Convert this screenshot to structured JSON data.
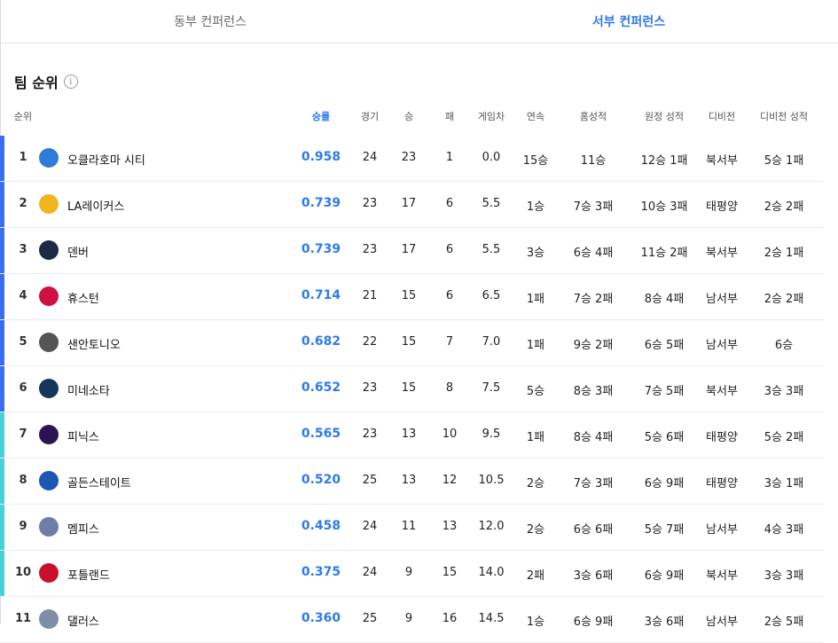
{
  "tabs": [
    {
      "label": "동부 컨퍼런스",
      "active": false
    },
    {
      "label": "서부 컨퍼런스",
      "active": true
    }
  ],
  "section": {
    "title": "팀 순위",
    "info_icon": "info-icon"
  },
  "columns": [
    "순위",
    "승률",
    "경기",
    "승",
    "패",
    "게임차",
    "연속",
    "홈성적",
    "원정 성적",
    "디비전",
    "디비전 성적"
  ],
  "colors": {
    "accent": "#2f7bea",
    "playoff_bar": "#3b6df0",
    "playin_bar": "#45d3d9"
  },
  "teams": [
    {
      "rank": "1",
      "name": "오클라호마 시티",
      "pct": "0.958",
      "gp": "24",
      "w": "23",
      "l": "1",
      "gb": "0.0",
      "streak": "15승",
      "home": "11승",
      "away": "12승 1패",
      "div": "북서부",
      "div_rec": "5승 1패",
      "zone": "playoff",
      "logo": "okc-thunder-logo",
      "logo_color": "#2f7bd9"
    },
    {
      "rank": "2",
      "name": "LA레이커스",
      "pct": "0.739",
      "gp": "23",
      "w": "17",
      "l": "6",
      "gb": "5.5",
      "streak": "1승",
      "home": "7승 3패",
      "away": "10승 3패",
      "div": "태평양",
      "div_rec": "2승 2패",
      "zone": "playoff",
      "logo": "lakers-logo",
      "logo_color": "#f2b51f"
    },
    {
      "rank": "3",
      "name": "덴버",
      "pct": "0.739",
      "gp": "23",
      "w": "17",
      "l": "6",
      "gb": "5.5",
      "streak": "3승",
      "home": "6승 4패",
      "away": "11승 2패",
      "div": "북서부",
      "div_rec": "2승 1패",
      "zone": "playoff",
      "logo": "nuggets-logo",
      "logo_color": "#1d2a44"
    },
    {
      "rank": "4",
      "name": "휴스턴",
      "pct": "0.714",
      "gp": "21",
      "w": "15",
      "l": "6",
      "gb": "6.5",
      "streak": "1패",
      "home": "7승 2패",
      "away": "8승 4패",
      "div": "남서부",
      "div_rec": "2승 2패",
      "zone": "playoff",
      "logo": "rockets-logo",
      "logo_color": "#ce1141"
    },
    {
      "rank": "5",
      "name": "샌안토니오",
      "pct": "0.682",
      "gp": "22",
      "w": "15",
      "l": "7",
      "gb": "7.0",
      "streak": "1패",
      "home": "9승 2패",
      "away": "6승 5패",
      "div": "남서부",
      "div_rec": "6승",
      "zone": "playoff",
      "logo": "spurs-logo",
      "logo_color": "#555555"
    },
    {
      "rank": "6",
      "name": "미네소타",
      "pct": "0.652",
      "gp": "23",
      "w": "15",
      "l": "8",
      "gb": "7.5",
      "streak": "5승",
      "home": "8승 3패",
      "away": "7승 5패",
      "div": "북서부",
      "div_rec": "3승 3패",
      "zone": "playoff",
      "logo": "timberwolves-logo",
      "logo_color": "#16375b"
    },
    {
      "rank": "7",
      "name": "피닉스",
      "pct": "0.565",
      "gp": "23",
      "w": "13",
      "l": "10",
      "gb": "9.5",
      "streak": "1패",
      "home": "8승 4패",
      "away": "5승 6패",
      "div": "태평양",
      "div_rec": "5승 2패",
      "zone": "playin",
      "logo": "suns-logo",
      "logo_color": "#2b1454"
    },
    {
      "rank": "8",
      "name": "골든스테이트",
      "pct": "0.520",
      "gp": "25",
      "w": "13",
      "l": "12",
      "gb": "10.5",
      "streak": "2승",
      "home": "7승 3패",
      "away": "6승 9패",
      "div": "태평양",
      "div_rec": "3승 1패",
      "zone": "playin",
      "logo": "warriors-logo",
      "logo_color": "#1d56b3"
    },
    {
      "rank": "9",
      "name": "멤피스",
      "pct": "0.458",
      "gp": "24",
      "w": "11",
      "l": "13",
      "gb": "12.0",
      "streak": "2승",
      "home": "6승 6패",
      "away": "5승 7패",
      "div": "남서부",
      "div_rec": "4승 3패",
      "zone": "playin",
      "logo": "grizzlies-logo",
      "logo_color": "#6b7fa8"
    },
    {
      "rank": "10",
      "name": "포틀랜드",
      "pct": "0.375",
      "gp": "24",
      "w": "9",
      "l": "15",
      "gb": "14.0",
      "streak": "2패",
      "home": "3승 6패",
      "away": "6승 9패",
      "div": "북서부",
      "div_rec": "3승 3패",
      "zone": "playin",
      "logo": "trail-blazers-logo",
      "logo_color": "#c8102e"
    },
    {
      "rank": "11",
      "name": "댈러스",
      "pct": "0.360",
      "gp": "25",
      "w": "9",
      "l": "16",
      "gb": "14.5",
      "streak": "1승",
      "home": "6승 9패",
      "away": "3승 6패",
      "div": "남서부",
      "div_rec": "2승 5패",
      "zone": "none",
      "logo": "mavericks-logo",
      "logo_color": "#7d8fa6"
    }
  ]
}
